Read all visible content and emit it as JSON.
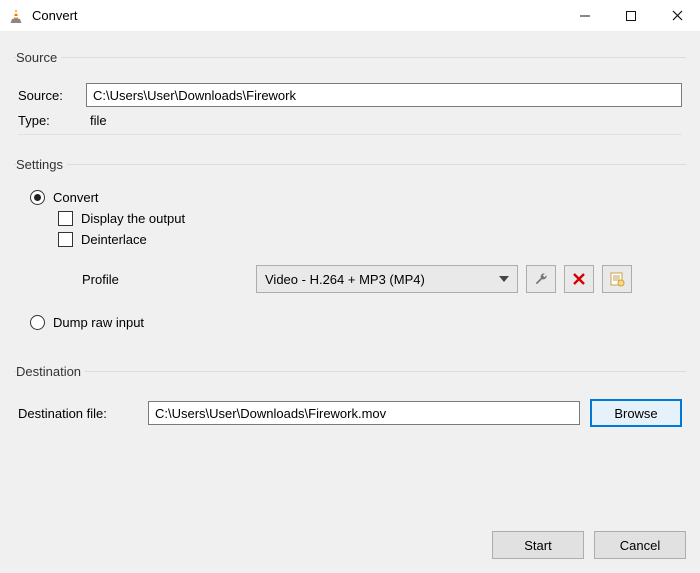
{
  "window": {
    "title": "Convert"
  },
  "source_group": {
    "legend": "Source",
    "source_label": "Source:",
    "source_value": "C:\\Users\\User\\Downloads\\Firework",
    "type_label": "Type:",
    "type_value": "file"
  },
  "settings_group": {
    "legend": "Settings",
    "convert_label": "Convert",
    "convert_selected": true,
    "display_output_label": "Display the output",
    "display_output_checked": false,
    "deinterlace_label": "Deinterlace",
    "deinterlace_checked": false,
    "profile_label": "Profile",
    "profile_value": "Video - H.264 + MP3 (MP4)",
    "dump_raw_label": "Dump raw input",
    "dump_raw_selected": false
  },
  "destination_group": {
    "legend": "Destination",
    "dest_file_label": "Destination file:",
    "dest_file_value": "C:\\Users\\User\\Downloads\\Firework.mov",
    "browse_label": "Browse"
  },
  "footer": {
    "start_label": "Start",
    "cancel_label": "Cancel"
  }
}
